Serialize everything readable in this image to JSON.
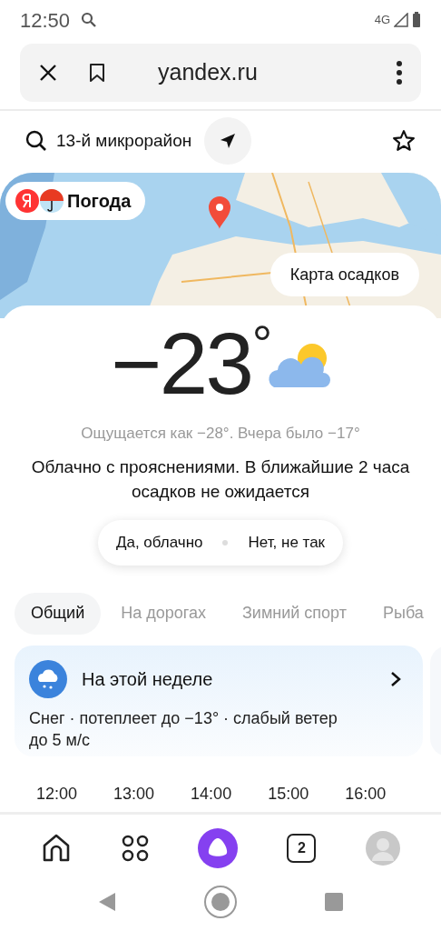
{
  "status_bar": {
    "time": "12:50",
    "network": "4G"
  },
  "browser": {
    "url": "yandex.ru",
    "tab_count": "2"
  },
  "location": {
    "name": "13-й микрорайон"
  },
  "map": {
    "brand": "Погода",
    "button": "Карта осадков"
  },
  "current": {
    "temperature": "−23",
    "degree": "°",
    "feels": "Ощущается как −28°. Вчера было −17°",
    "description": "Облачно с прояснениями. В ближайшие 2 часа осадков не ожидается",
    "answers": [
      "Да, облачно",
      "Нет, не так"
    ]
  },
  "tabs": [
    {
      "label": "Общий",
      "selected": true
    },
    {
      "label": "На дорогах",
      "selected": false
    },
    {
      "label": "Зимний спорт",
      "selected": false
    },
    {
      "label": "Рыба",
      "selected": false
    }
  ],
  "week_card": {
    "title": "На этой неделе",
    "text": "Снег · потеплеет до −13° · слабый ветер до 5 м/с"
  },
  "hours": [
    "12:00",
    "13:00",
    "14:00",
    "15:00",
    "16:00"
  ]
}
